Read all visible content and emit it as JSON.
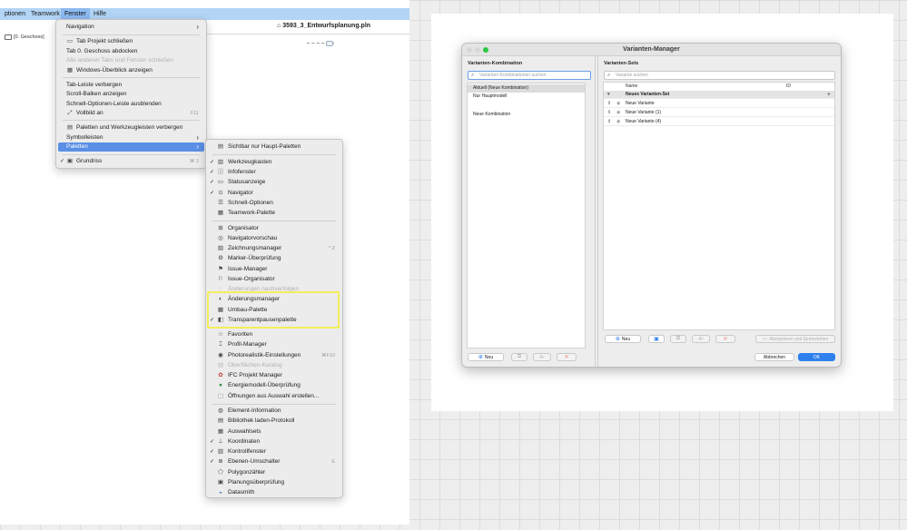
{
  "menubar": {
    "items": [
      {
        "label": "ptionen"
      },
      {
        "label": "Teamwork"
      },
      {
        "label": "Fenster"
      },
      {
        "label": "Hilfe"
      }
    ]
  },
  "document": {
    "title": "3593_3_Entwurfsplanung.pln",
    "story_tab": "[0. Geschoss]"
  },
  "main_menu": {
    "navigation": "Navigation",
    "close_tab": "Tab Projekt schließen",
    "undock_tab": "Tab 0. Geschoss abdocken",
    "close_other_tabs": "Alle anderen Tabs und Fenster schließen",
    "windows_overview": "Windows-Überblick anzeigen",
    "hide_tabbar": "Tab-Leiste verbergen",
    "show_scrollbars": "Scroll-Balken anzeigen",
    "hide_quick_options": "Schnell-Optionen-Leiste ausblenden",
    "fullscreen": "Vollbild an",
    "fullscreen_shortcut": "F11",
    "hide_palettes": "Paletten und Werkzeugleisten verbergen",
    "toolbars": "Symbolleisten",
    "palettes": "Paletten",
    "floor_plan": "Grundriss",
    "floor_plan_shortcut": "⌘ 2"
  },
  "palettes_menu": {
    "visible_main": "Sichtbar nur Haupt-Paletten",
    "toolbox": "Werkzeugkasten",
    "info_box": "Infofenster",
    "status_bar": "Statusanzeige",
    "navigator": "Navigator",
    "quick_options": "Schnell-Optionen",
    "teamwork": "Teamwork-Palette",
    "organizer": "Organisator",
    "navigator_preview": "Navigatorvorschau",
    "drawing_manager": "Zeichnungsmanager",
    "drawing_manager_shortcut": "^ Z",
    "marker_check": "Marker-Überprüfung",
    "issue_manager": "Issue-Manager",
    "issue_organizer": "Issue-Organisator",
    "track_changes": "Änderungen nachverfolgen",
    "change_manager": "Änderungsmanager",
    "renovation": "Umbau-Palette",
    "trace_palette": "Transparentpausenpalette",
    "favorites": "Favoriten",
    "profile_manager": "Profil-Manager",
    "photorender": "Photorealistik-Einstellungen",
    "photorender_shortcut": "⌘F10",
    "surface_catalog": "Oberflächen-Katalog",
    "ifc_manager": "IFC Projekt Manager",
    "energy_check": "Energiemodell-Überprüfung",
    "openings": "Öffnungen aus Auswahl erstellen...",
    "element_info": "Element-Information",
    "library_report": "Bibliothek laden-Protokoll",
    "selection_sets": "Auswahlsets",
    "coordinates": "Koordinaten",
    "control_box": "Kontrollfenster",
    "layer_switch": "Ebenen-Umschalter",
    "layer_switch_shortcut": "E",
    "polygon_counter": "Polygonzähler",
    "design_check": "Planungsüberprüfung",
    "datasmith": "Datasmith"
  },
  "dialog": {
    "title": "Varianten-Manager",
    "left": {
      "heading": "Varianten-Kombination",
      "search_placeholder": "Varianten-Kombinationen suchen",
      "rows": [
        {
          "label": "Aktuell (Neue Kombination)"
        },
        {
          "label": "Nur Hauptmodell"
        },
        {
          "label": ""
        },
        {
          "label": "Neue Kombination"
        }
      ],
      "new_button": "Neu",
      "rename_button": "A²"
    },
    "right": {
      "heading": "Varianten-Sets",
      "search_placeholder": "Variante suchen",
      "col_name": "Name",
      "col_id": "ID",
      "set_name": "Neues Varianten-Set",
      "variants": [
        {
          "name": "Neue Variante"
        },
        {
          "name": "Neue Variante (1)"
        },
        {
          "name": "Neue Variante (4)"
        }
      ],
      "new_button": "Neu",
      "rename_button": "A²",
      "apply_button": "Akzeptieren und Einbeziehen"
    },
    "cancel_button": "Abbrechen",
    "ok_button": "OK"
  },
  "colors": {
    "menubar": "#b2d4f5",
    "menu_highlight": "#5a8fe6",
    "annotation_box": "#f3ee5a",
    "primary_button": "#2f80ed"
  }
}
